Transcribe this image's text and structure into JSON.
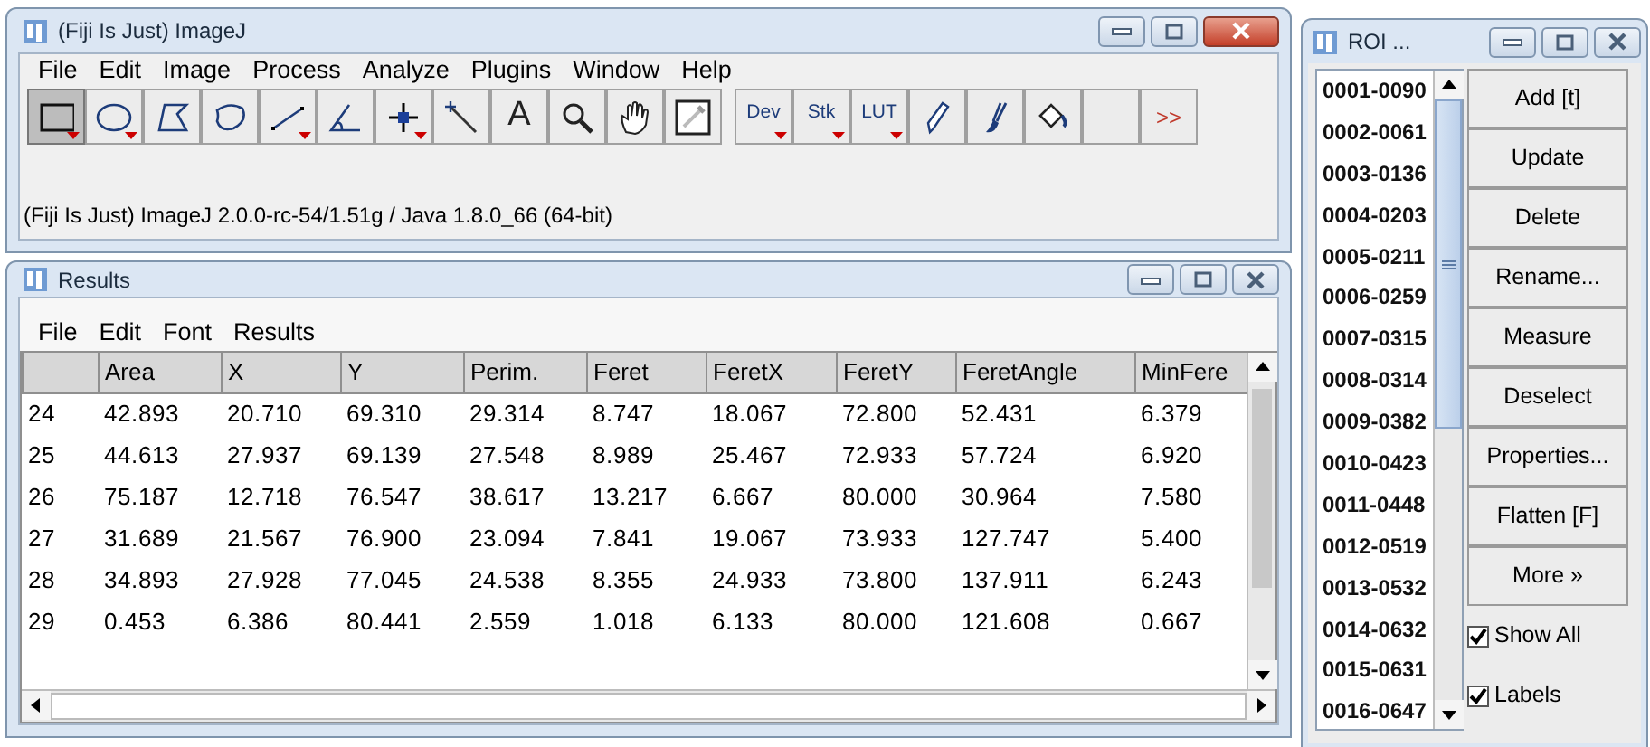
{
  "main_window": {
    "title": "(Fiji Is Just) ImageJ",
    "menu": [
      "File",
      "Edit",
      "Image",
      "Process",
      "Analyze",
      "Plugins",
      "Window",
      "Help"
    ],
    "tools": [
      {
        "kind": "rectangle",
        "selected": true,
        "has_menu": true
      },
      {
        "kind": "oval",
        "selected": false,
        "has_menu": true
      },
      {
        "kind": "polygon",
        "selected": false,
        "has_menu": false
      },
      {
        "kind": "freehand",
        "selected": false,
        "has_menu": false
      },
      {
        "kind": "line",
        "selected": false,
        "has_menu": true
      },
      {
        "kind": "angle",
        "selected": false,
        "has_menu": false
      },
      {
        "kind": "point",
        "selected": false,
        "has_menu": true
      },
      {
        "kind": "wand",
        "selected": false,
        "has_menu": false
      },
      {
        "kind": "text",
        "label": "A",
        "selected": false,
        "has_menu": false
      },
      {
        "kind": "zoom",
        "selected": false,
        "has_menu": false
      },
      {
        "kind": "hand",
        "selected": false,
        "has_menu": false
      },
      {
        "kind": "dropper",
        "selected": false,
        "has_menu": false
      },
      {
        "kind": "label",
        "label": "Dev",
        "selected": false,
        "has_menu": true
      },
      {
        "kind": "label",
        "label": "Stk",
        "selected": false,
        "has_menu": true
      },
      {
        "kind": "label",
        "label": "LUT",
        "selected": false,
        "has_menu": true
      },
      {
        "kind": "pencil",
        "selected": false,
        "has_menu": false
      },
      {
        "kind": "brush",
        "selected": false,
        "has_menu": false
      },
      {
        "kind": "fill",
        "selected": false,
        "has_menu": false
      },
      {
        "kind": "blank",
        "selected": false,
        "has_menu": false
      },
      {
        "kind": "more",
        "label": ">>",
        "selected": false,
        "has_menu": false
      }
    ],
    "status": "(Fiji Is Just) ImageJ 2.0.0-rc-54/1.51g / Java 1.8.0_66 (64-bit)"
  },
  "results_window": {
    "title": "Results",
    "menu": [
      "File",
      "Edit",
      "Font",
      "Results"
    ],
    "columns": [
      "",
      "Area",
      "X",
      "Y",
      "Perim.",
      "Feret",
      "FeretX",
      "FeretY",
      "FeretAngle",
      "MinFere"
    ],
    "rows": [
      [
        "24",
        "42.893",
        "20.710",
        "69.310",
        "29.314",
        "8.747",
        "18.067",
        "72.800",
        "52.431",
        "6.379"
      ],
      [
        "25",
        "44.613",
        "27.937",
        "69.139",
        "27.548",
        "8.989",
        "25.467",
        "72.933",
        "57.724",
        "6.920"
      ],
      [
        "26",
        "75.187",
        "12.718",
        "76.547",
        "38.617",
        "13.217",
        "6.667",
        "80.000",
        "30.964",
        "7.580"
      ],
      [
        "27",
        "31.689",
        "21.567",
        "76.900",
        "23.094",
        "7.841",
        "19.067",
        "73.933",
        "127.747",
        "5.400"
      ],
      [
        "28",
        "34.893",
        "27.928",
        "77.045",
        "24.538",
        "8.355",
        "24.933",
        "73.800",
        "137.911",
        "6.243"
      ],
      [
        "29",
        "0.453",
        "6.386",
        "80.441",
        "2.559",
        "1.018",
        "6.133",
        "80.000",
        "121.608",
        "0.667"
      ]
    ]
  },
  "roi_window": {
    "title": "ROI ...",
    "items": [
      "0001-0090",
      "0002-0061",
      "0003-0136",
      "0004-0203",
      "0005-0211",
      "0006-0259",
      "0007-0315",
      "0008-0314",
      "0009-0382",
      "0010-0423",
      "0011-0448",
      "0012-0519",
      "0013-0532",
      "0014-0632",
      "0015-0631",
      "0016-0647"
    ],
    "buttons": [
      "Add [t]",
      "Update",
      "Delete",
      "Rename...",
      "Measure",
      "Deselect",
      "Properties...",
      "Flatten [F]",
      "More »"
    ],
    "checkboxes": [
      {
        "label": "Show All",
        "checked": true
      },
      {
        "label": "Labels",
        "checked": true
      }
    ]
  }
}
